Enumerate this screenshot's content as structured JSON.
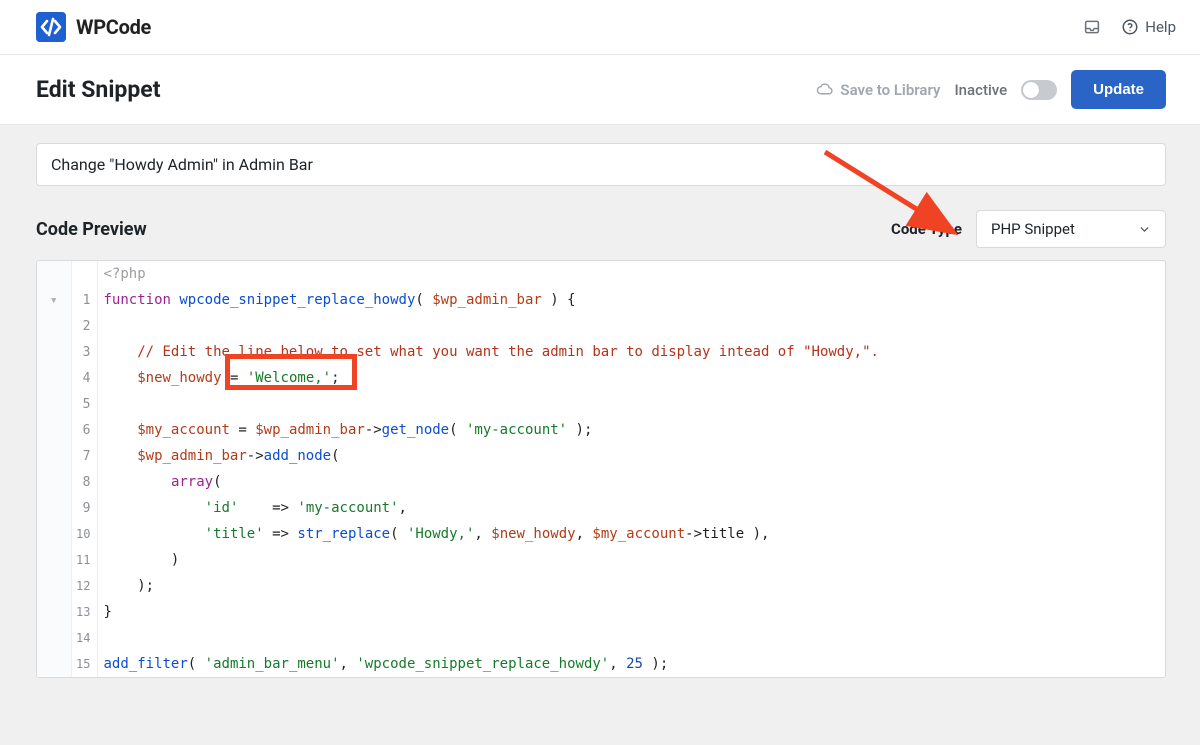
{
  "brand": {
    "name": "WPCode"
  },
  "header": {
    "help_label": "Help"
  },
  "titlebar": {
    "title": "Edit Snippet",
    "save_library_label": "Save to Library",
    "toggle_state_label": "Inactive",
    "update_label": "Update"
  },
  "snippet": {
    "title": "Change \"Howdy Admin\" in Admin Bar"
  },
  "preview": {
    "heading": "Code Preview",
    "code_type_label": "Code Type",
    "code_type_value": "PHP Snippet"
  },
  "code": {
    "line0": "<?php",
    "fn_keyword": "function",
    "fn_name": "wpcode_snippet_replace_howdy",
    "param": "$wp_admin_bar",
    "brace_open": " ) {",
    "comment": "// Edit the line below to set what you want the admin bar to display intead of \"Howdy,\".",
    "var_new_howdy": "$new_howdy",
    "welcome": "'Welcome,'",
    "semicolon": ";",
    "var_my_account": "$my_account",
    "wp_admin_bar": "$wp_admin_bar",
    "get_node": "get_node",
    "my_account_str": "'my-account'",
    "add_node": "add_node",
    "array": "array",
    "id_key": "'id'",
    "arrow": " => ",
    "title_key": "'title'",
    "str_replace": "str_replace",
    "howdy_str": "'Howdy,'",
    "arrow_sym": "->",
    "title_prop": "title",
    "brace_close": "}",
    "add_filter": "add_filter",
    "admin_bar_menu": "'admin_bar_menu'",
    "fn_ref": "'wpcode_snippet_replace_howdy'",
    "priority": "25"
  },
  "line_numbers": [
    "1",
    "2",
    "3",
    "4",
    "5",
    "6",
    "7",
    "8",
    "9",
    "10",
    "11",
    "12",
    "13",
    "14",
    "15"
  ]
}
